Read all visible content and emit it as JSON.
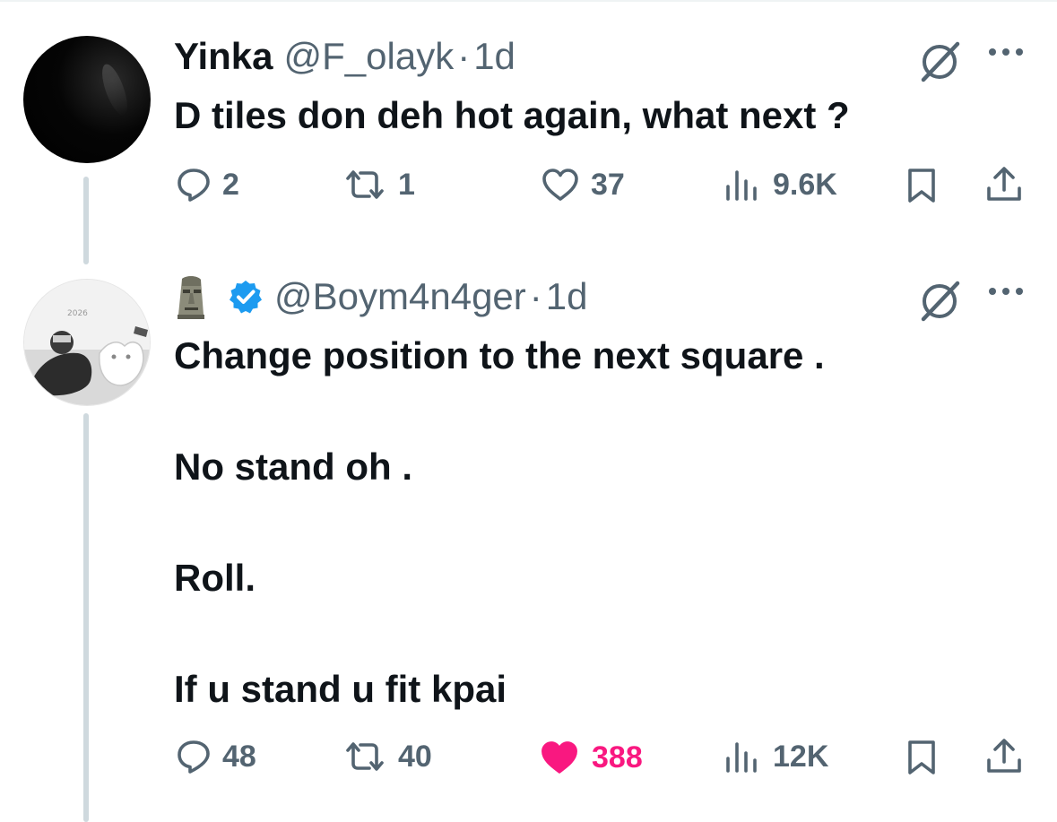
{
  "tweets": [
    {
      "display_name": "Yinka",
      "handle": "@F_olayk",
      "separator": "·",
      "time": "1d",
      "text": "D tiles don deh hot again, what next ?",
      "actions": {
        "replies": "2",
        "reposts": "1",
        "likes": "37",
        "views": "9.6K"
      },
      "liked": false
    },
    {
      "display_name": "",
      "display_name_emoji": "moai-emoji",
      "verified": true,
      "handle": "@Boym4n4ger",
      "separator": "·",
      "time": "1d",
      "text": "Change position to the next square .\n\nNo stand oh .\n\nRoll.\n\nIf u stand u fit kpai",
      "actions": {
        "replies": "48",
        "reposts": "40",
        "likes": "388",
        "views": "12K"
      },
      "liked": true
    }
  ],
  "colors": {
    "text_primary": "#0f1419",
    "text_secondary": "#536471",
    "like_active": "#f91880",
    "verified_blue": "#1d9bf0",
    "thread_line": "#cfd9de"
  },
  "icons": [
    "reply-icon",
    "repost-icon",
    "like-icon",
    "views-icon",
    "bookmark-icon",
    "share-icon",
    "grok-icon",
    "more-icon",
    "verified-badge-icon"
  ]
}
